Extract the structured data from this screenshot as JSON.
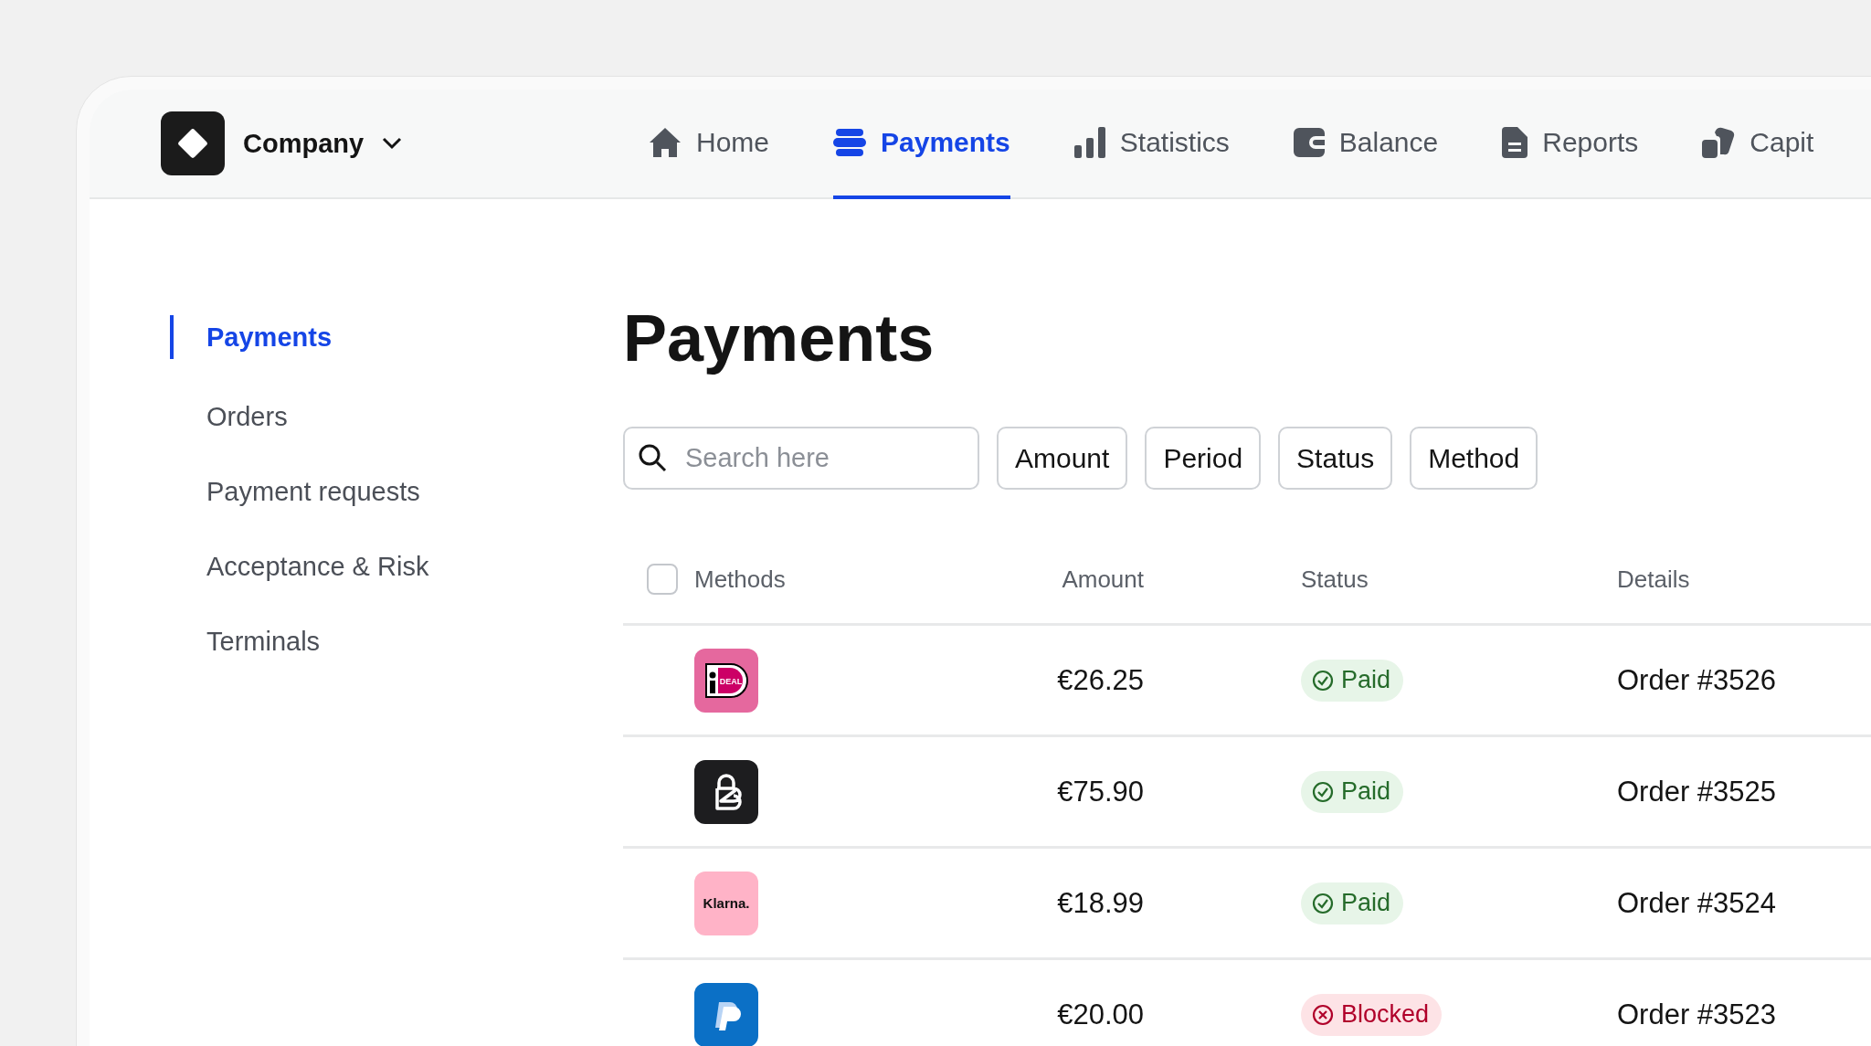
{
  "brand": {
    "name": "Company"
  },
  "nav": [
    {
      "label": "Home",
      "selected": false
    },
    {
      "label": "Payments",
      "selected": true
    },
    {
      "label": "Statistics",
      "selected": false
    },
    {
      "label": "Balance",
      "selected": false
    },
    {
      "label": "Reports",
      "selected": false
    },
    {
      "label": "Capit",
      "selected": false
    }
  ],
  "sidebar": {
    "items": [
      {
        "label": "Payments",
        "selected": true
      },
      {
        "label": "Orders",
        "selected": false
      },
      {
        "label": "Payment requests",
        "selected": false
      },
      {
        "label": "Acceptance & Risk",
        "selected": false
      },
      {
        "label": "Terminals",
        "selected": false
      }
    ]
  },
  "page_title": "Payments",
  "search": {
    "placeholder": "Search here"
  },
  "filters": [
    "Amount",
    "Period",
    "Status",
    "Method"
  ],
  "table": {
    "select_all": {
      "checked": false
    },
    "columns": [
      "Methods",
      "Amount",
      "Status",
      "Details"
    ],
    "rows": [
      {
        "method": {
          "kind": "ideal",
          "text": "DEAL"
        },
        "amount": "€26.25",
        "status": {
          "kind": "paid",
          "label": "Paid"
        },
        "details": "Order #3526"
      },
      {
        "method": {
          "kind": "b"
        },
        "amount": "€75.90",
        "status": {
          "kind": "paid",
          "label": "Paid"
        },
        "details": "Order #3525"
      },
      {
        "method": {
          "kind": "klarna",
          "text": "Klarna."
        },
        "amount": "€18.99",
        "status": {
          "kind": "paid",
          "label": "Paid"
        },
        "details": "Order #3524"
      },
      {
        "method": {
          "kind": "paypal"
        },
        "amount": "€20.00",
        "status": {
          "kind": "blocked",
          "label": "Blocked"
        },
        "details": "Order #3523"
      }
    ]
  }
}
